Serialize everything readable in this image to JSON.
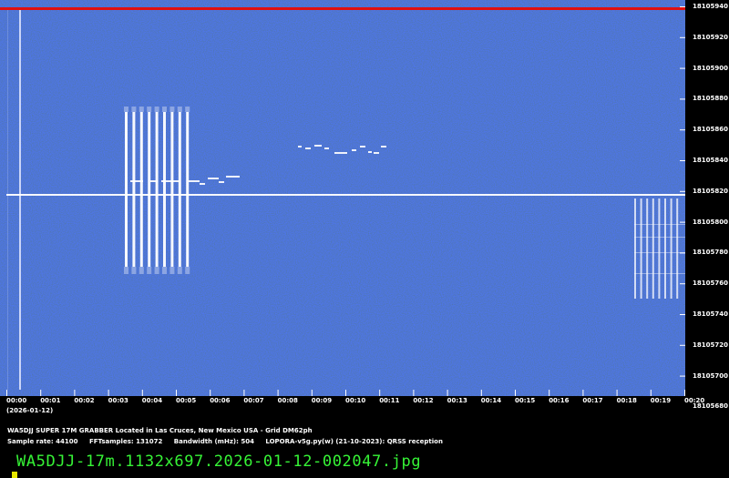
{
  "spectrogram": {
    "date": "(2026-01-12)",
    "time_labels": [
      "00:00",
      "00:01",
      "00:02",
      "00:03",
      "00:04",
      "00:05",
      "00:06",
      "00:07",
      "00:08",
      "00:09",
      "00:10",
      "00:11",
      "00:12",
      "00:13",
      "00:14",
      "00:15",
      "00:16",
      "00:17",
      "00:18",
      "00:19",
      "00:20"
    ],
    "freq_labels": [
      "18105940",
      "18105920",
      "18105900",
      "18105880",
      "18105860",
      "18105840",
      "18105820",
      "18105800",
      "18105780",
      "18105760",
      "18105740",
      "18105720",
      "18105700",
      "18105680"
    ],
    "colors": {
      "background": "#1a3a8c",
      "signal": "#ffffff",
      "top_line": "#e01010",
      "filename": "#36f436"
    }
  },
  "info": {
    "station": "WA5DJJ SUPER 17M GRABBER Located in Las Cruces, New Mexico USA - Grid DM62ph",
    "sample_rate": "Sample rate: 44100",
    "fft_samples": "FFTsamples: 131072",
    "bandwidth": "Bandwidth (mHz): 504",
    "software": "LOPORA-v5g.py(w) (21-10-2023): QRSS reception"
  },
  "filename": "WA5DJJ-17m.1132x697.2026-01-12-002047.jpg"
}
